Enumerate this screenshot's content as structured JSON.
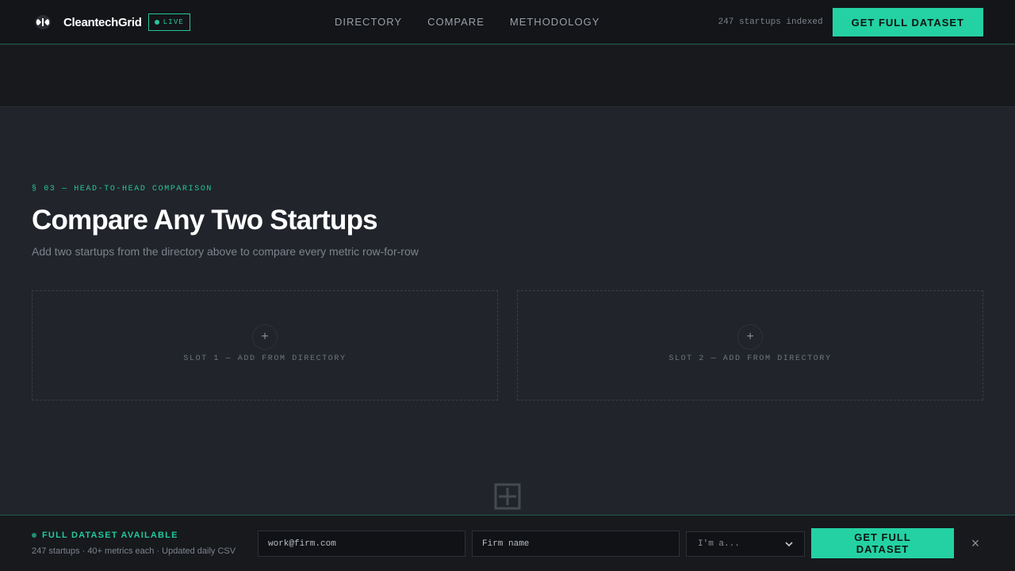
{
  "header": {
    "brand": "CleantechGrid",
    "live_badge": "LIVE",
    "nav": [
      "DIRECTORY",
      "COMPARE",
      "METHODOLOGY"
    ],
    "count_text": "247 startups indexed",
    "cta_label": "GET FULL DATASET"
  },
  "main": {
    "section_label": "§ 03 — HEAD-TO-HEAD COMPARISON",
    "title": "Compare Any Two Startups",
    "subtitle": "Add two startups from the directory above to compare every metric row-for-row",
    "slots": [
      {
        "plus": "+",
        "label": "SLOT 1 — ADD FROM DIRECTORY"
      },
      {
        "plus": "+",
        "label": "SLOT 2 — ADD FROM DIRECTORY"
      }
    ]
  },
  "bottom_bar": {
    "title": "FULL DATASET AVAILABLE",
    "subtitle": "247 startups · 40+ metrics each · Updated daily CSV",
    "email_placeholder": "work@firm.com",
    "firm_placeholder": "Firm name",
    "role_select": "I'm a...",
    "cta_label": "GET FULL DATASET",
    "close": "×"
  },
  "colors": {
    "accent": "#24d1a3",
    "background": "#21242b",
    "header_bg": "#131518"
  }
}
